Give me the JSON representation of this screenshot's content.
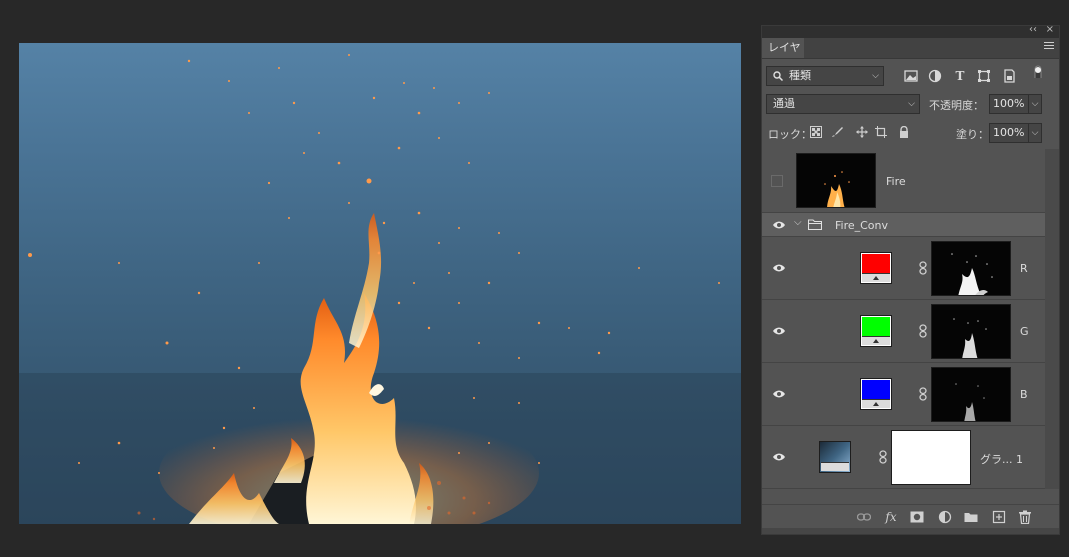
{
  "panel": {
    "tab_label": "レイヤー",
    "collapse_glyph": "‹‹",
    "close_glyph": "×",
    "filter": {
      "label": "種類",
      "icon": "search-icon"
    },
    "filter_icons": [
      "image-filter-icon",
      "adjustment-filter-icon",
      "type-filter-icon",
      "shape-filter-icon",
      "smart-object-filter-icon",
      "filter-toggle-icon"
    ],
    "blend_mode": "通過",
    "opacity_label": "不透明度：",
    "opacity_value": "100%",
    "lock_label": "ロック：",
    "lock_icons": [
      "lock-transparent-icon",
      "lock-image-icon",
      "lock-position-icon",
      "lock-artboard-icon",
      "lock-all-icon"
    ],
    "fill_label": "塗り：",
    "fill_value": "100%",
    "layers": [
      {
        "name": "Fire",
        "visible": false,
        "kind": "pixel"
      },
      {
        "name": "Fire_Conv",
        "visible": true,
        "kind": "group"
      },
      {
        "name": "R",
        "visible": true,
        "kind": "adjustment",
        "swatch": "#ff0000"
      },
      {
        "name": "G",
        "visible": true,
        "kind": "adjustment",
        "swatch": "#00ff00"
      },
      {
        "name": "B",
        "visible": true,
        "kind": "adjustment",
        "swatch": "#0000ff"
      },
      {
        "name": "グラ... 1",
        "visible": true,
        "kind": "gradient-map"
      }
    ],
    "bottom_icons": [
      "link-layers-icon",
      "fx-icon",
      "add-mask-icon",
      "new-adjustment-icon",
      "new-group-icon",
      "new-layer-icon",
      "delete-icon"
    ],
    "fx_label": "fx"
  },
  "colors": {
    "panel_bg": "#535353",
    "group_row_bg": "#5f5f5f",
    "canvas_top": "#5582a6",
    "canvas_bottom": "#2f4c64"
  }
}
